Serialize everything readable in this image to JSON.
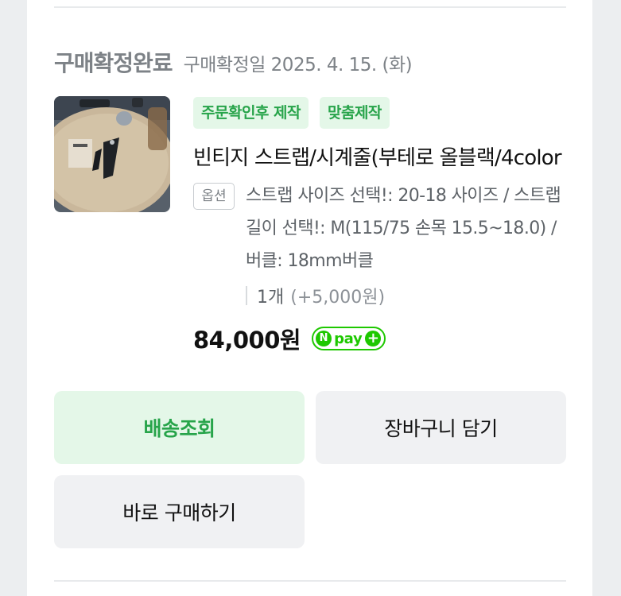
{
  "order": {
    "status": "구매확정완료",
    "confirm_date": "구매확정일 2025. 4. 15. (화)"
  },
  "product": {
    "image_icon": "watch-strap-product-photo",
    "tags": [
      "주문확인후 제작",
      "맞춤제작"
    ],
    "name": "빈티지 스트랩/시계줄(부테로 올블랙/4color",
    "option_badge": "옵션",
    "option_text": "스트랩 사이즈 선택!: 20-18 사이즈 / 스트랩 길이 선택!: M(115/75 손목 15.5~18.0) / 버클: 18mm버클",
    "quantity": "1개",
    "extra_price": "(+5,000원)",
    "price": "84,000원"
  },
  "npay": {
    "n": "N",
    "label": "pay",
    "plus": "+",
    "color": "#1ec800"
  },
  "buttons": {
    "track": "배송조회",
    "cart": "장바구니 담기",
    "buy_now": "바로 구매하기"
  },
  "colors": {
    "accent_green": "#27a44a",
    "tag_bg": "#e4f7e8",
    "button_bg": "#f0f1f3"
  }
}
